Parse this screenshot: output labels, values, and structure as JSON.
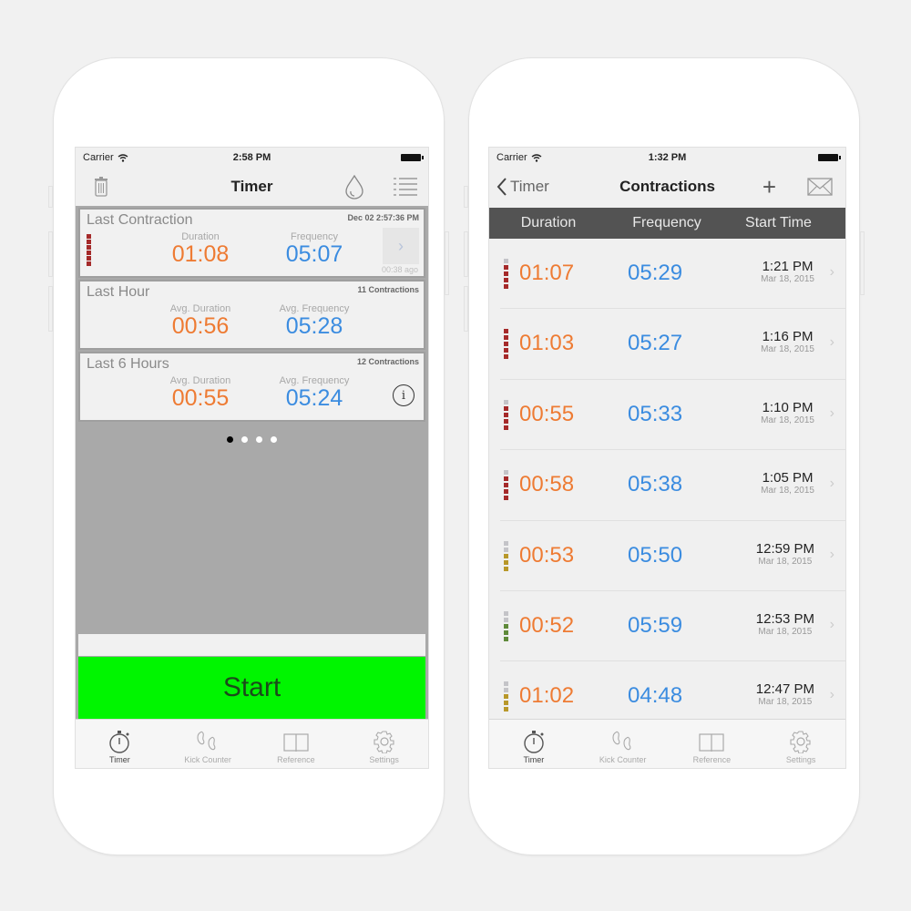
{
  "left_screen": {
    "status": {
      "carrier": "Carrier",
      "time": "2:58 PM"
    },
    "nav": {
      "title": "Timer",
      "left_icon": "trash-icon",
      "right_icons": [
        "drop-icon",
        "list-icon"
      ]
    },
    "last_contraction": {
      "title": "Last Contraction",
      "timestamp": "Dec 02 2:57:36 PM",
      "duration_label": "Duration",
      "duration": "01:08",
      "frequency_label": "Frequency",
      "frequency": "05:07",
      "ago": "00:38 ago",
      "intensity_bars": [
        "red",
        "red",
        "red",
        "red",
        "red",
        "red"
      ]
    },
    "last_hour": {
      "title": "Last Hour",
      "count": "11 Contractions",
      "duration_label": "Avg. Duration",
      "duration": "00:56",
      "frequency_label": "Avg. Frequency",
      "frequency": "05:28"
    },
    "last_6_hours": {
      "title": "Last 6 Hours",
      "count": "12 Contractions",
      "duration_label": "Avg. Duration",
      "duration": "00:55",
      "frequency_label": "Avg. Frequency",
      "frequency": "05:24",
      "info_icon": "i"
    },
    "page_dots": {
      "count": 4,
      "active": 0
    },
    "start_button": "Start"
  },
  "right_screen": {
    "status": {
      "carrier": "Carrier",
      "time": "1:32 PM"
    },
    "nav": {
      "back_label": "Timer",
      "title": "Contractions",
      "add_icon": "+",
      "mail_icon": "mail-icon"
    },
    "table_header": {
      "duration": "Duration",
      "frequency": "Frequency",
      "start_time": "Start Time"
    },
    "rows": [
      {
        "duration": "01:07",
        "frequency": "05:29",
        "time": "1:21 PM",
        "date": "Mar 18, 2015",
        "bars": [
          "gray",
          "red",
          "red",
          "red",
          "red"
        ]
      },
      {
        "duration": "01:03",
        "frequency": "05:27",
        "time": "1:16 PM",
        "date": "Mar 18, 2015",
        "bars": [
          "red",
          "red",
          "red",
          "red",
          "red"
        ]
      },
      {
        "duration": "00:55",
        "frequency": "05:33",
        "time": "1:10 PM",
        "date": "Mar 18, 2015",
        "bars": [
          "gray",
          "red",
          "red",
          "red",
          "red"
        ]
      },
      {
        "duration": "00:58",
        "frequency": "05:38",
        "time": "1:05 PM",
        "date": "Mar 18, 2015",
        "bars": [
          "gray",
          "red",
          "red",
          "red",
          "red"
        ]
      },
      {
        "duration": "00:53",
        "frequency": "05:50",
        "time": "12:59 PM",
        "date": "Mar 18, 2015",
        "bars": [
          "gray",
          "gray",
          "yellow",
          "yellow",
          "yellow"
        ]
      },
      {
        "duration": "00:52",
        "frequency": "05:59",
        "time": "12:53 PM",
        "date": "Mar 18, 2015",
        "bars": [
          "gray",
          "gray",
          "green",
          "green",
          "green"
        ]
      },
      {
        "duration": "01:02",
        "frequency": "04:48",
        "time": "12:47 PM",
        "date": "Mar 18, 2015",
        "bars": [
          "gray",
          "gray",
          "yellow",
          "yellow",
          "yellow"
        ]
      }
    ]
  },
  "tabs": [
    {
      "label": "Timer",
      "icon": "stopwatch-icon",
      "active": true
    },
    {
      "label": "Kick Counter",
      "icon": "footprints-icon",
      "active": false
    },
    {
      "label": "Reference",
      "icon": "book-icon",
      "active": false
    },
    {
      "label": "Settings",
      "icon": "gear-icon",
      "active": false
    }
  ],
  "colors": {
    "duration": "#ee7b33",
    "frequency": "#3b8ce0",
    "start_button": "#00f500",
    "bar_red": "#a52a2a",
    "bar_gray": "#c4c4c8",
    "bar_yellow": "#b8982a",
    "bar_green": "#5f8a3a"
  }
}
